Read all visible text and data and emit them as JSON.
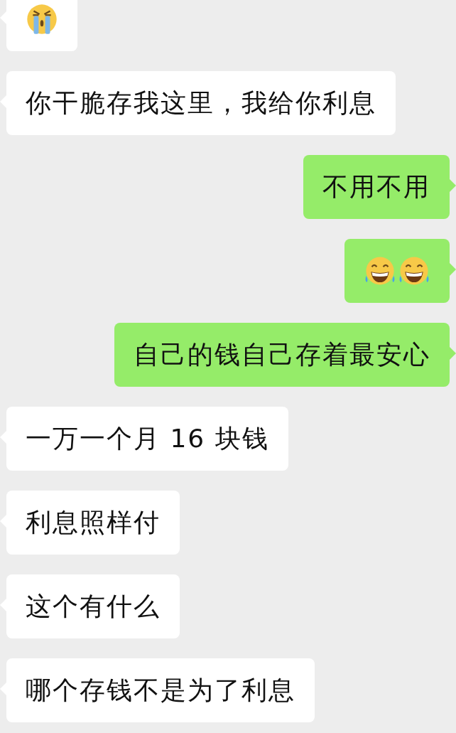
{
  "messages": [
    {
      "outgoing": false,
      "kind": "emoji",
      "emojis": [
        {
          "kind": "crying"
        }
      ]
    },
    {
      "outgoing": false,
      "kind": "text",
      "text": "你干脆存我这里，我给你利息"
    },
    {
      "outgoing": true,
      "kind": "text",
      "text": "不用不用"
    },
    {
      "outgoing": true,
      "kind": "emoji",
      "emojis": [
        {
          "kind": "laughing"
        },
        {
          "kind": "laughing"
        }
      ]
    },
    {
      "outgoing": true,
      "kind": "text",
      "text": "自己的钱自己存着最安心"
    },
    {
      "outgoing": false,
      "kind": "text",
      "text": "一万一个月 16 块钱"
    },
    {
      "outgoing": false,
      "kind": "text",
      "text": "利息照样付"
    },
    {
      "outgoing": false,
      "kind": "text",
      "text": "这个有什么"
    },
    {
      "outgoing": false,
      "kind": "text",
      "text": "哪个存钱不是为了利息"
    }
  ]
}
